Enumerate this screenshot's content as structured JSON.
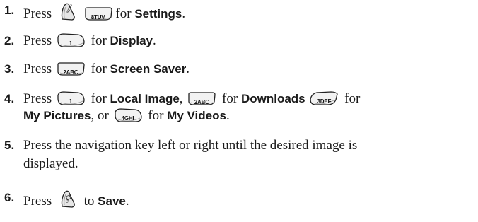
{
  "steps": [
    {
      "num": "1.",
      "press": "Press",
      "key_8": "8TUV",
      "for": "for",
      "target": "Settings",
      "end": "."
    },
    {
      "num": "2.",
      "press": "Press",
      "key_1": "1",
      "for": "for",
      "target": "Display",
      "end": "."
    },
    {
      "num": "3.",
      "press": "Press",
      "key_2": "2ABC",
      "for": "for",
      "target": "Screen Saver",
      "end": "."
    },
    {
      "num": "4.",
      "press": "Press",
      "key_1": "1",
      "for_a": "for",
      "target_a": "Local Image",
      "comma_a": ",",
      "key_2": "2ABC",
      "for_b": "for",
      "target_b": "Downloads",
      "key_3": "3DEF",
      "for_c": "for",
      "target_c": "My Pictures",
      "or": ", or",
      "key_4": "4GHI",
      "for_d": "for",
      "target_d": "My Videos",
      "end": "."
    },
    {
      "num": "5.",
      "line1": "Press the navigation key left or right until the desired image is",
      "line2": "displayed."
    },
    {
      "num": "6.",
      "press": "Press",
      "to": "to",
      "target": "Save",
      "end": "."
    }
  ],
  "icons": {
    "menu_key": "menu-ok-side-key-icon",
    "ok_key": "ok-side-key-icon",
    "number_key": "phone-number-key-icon"
  }
}
